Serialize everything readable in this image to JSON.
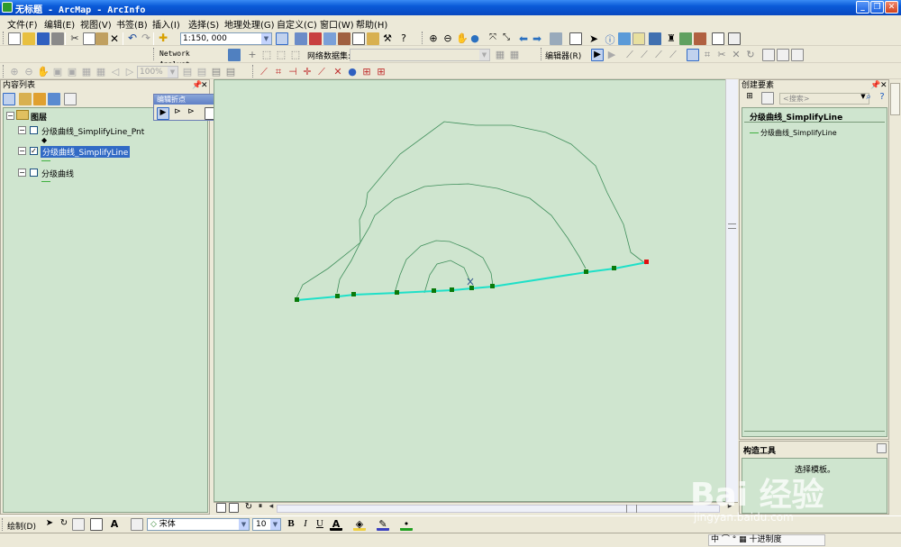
{
  "window": {
    "title": "无标题 - ArcMap - ArcInfo"
  },
  "menu": [
    "文件(F)",
    "编辑(E)",
    "视图(V)",
    "书签(B)",
    "插入(I)",
    "选择(S)",
    "地理处理(G)",
    "自定义(C)",
    "窗口(W)",
    "帮助(H)"
  ],
  "toolbar": {
    "scale": "1:150, 000",
    "network_analyst": "Network Analyst",
    "network_dataset_label": "网络数据集:",
    "zoom_percent": "100%",
    "editor": "编辑器(R)"
  },
  "toc": {
    "title": "内容列表",
    "root": "图层",
    "layers": [
      {
        "name": "分级曲线_SimplifyLine_Pnt",
        "checked": false,
        "selected": false
      },
      {
        "name": "分级曲线_SimplifyLine",
        "checked": true,
        "selected": true
      },
      {
        "name": "分级曲线",
        "checked": false,
        "selected": false
      }
    ]
  },
  "edit_vertices_toolbar": {
    "title": "编辑折点"
  },
  "create_features": {
    "title": "创建要素",
    "search_placeholder": "<搜索>",
    "group": "分级曲线_SimplifyLine",
    "item": "分级曲线_SimplifyLine"
  },
  "construction_tools": {
    "title": "构造工具",
    "message": "选择模板。"
  },
  "draw_toolbar": {
    "draw_label": "绘制(D)",
    "font": "宋体",
    "font_size": "10"
  },
  "status": {
    "ime_text": "中 ⌒ ° ▦ 十进制度"
  },
  "watermark": {
    "brand": "Bai 经验",
    "url": "jingyan.baidu.com"
  },
  "colors": {
    "map_bg": "#cfe5cf",
    "contour_line": "#3e8e5a",
    "simplify_line": "#1fe0c8",
    "vertex": "#0a7a0a",
    "end_vertex": "#e01010"
  }
}
